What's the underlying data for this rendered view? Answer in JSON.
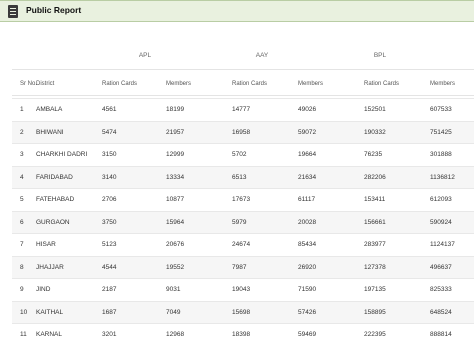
{
  "header": {
    "title": "Public Report",
    "icon": "report-icon"
  },
  "table": {
    "groups": [
      "APL",
      "AAY",
      "BPL"
    ],
    "columns": [
      "Sr No.",
      "District",
      "Ration Cards",
      "Members",
      "Ration Cards",
      "Members",
      "Ration Cards",
      "Members"
    ],
    "rows": [
      [
        "1",
        "AMBALA",
        "4561",
        "18199",
        "14777",
        "49026",
        "152501",
        "607533"
      ],
      [
        "2",
        "BHIWANI",
        "5474",
        "21957",
        "16958",
        "59072",
        "190332",
        "751425"
      ],
      [
        "3",
        "CHARKHI DADRI",
        "3150",
        "12999",
        "5702",
        "19664",
        "76235",
        "301888"
      ],
      [
        "4",
        "FARIDABAD",
        "3140",
        "13334",
        "6513",
        "21634",
        "282206",
        "1136812"
      ],
      [
        "5",
        "FATEHABAD",
        "2706",
        "10877",
        "17673",
        "61117",
        "153411",
        "612093"
      ],
      [
        "6",
        "GURGAON",
        "3750",
        "15964",
        "5979",
        "20028",
        "156661",
        "590924"
      ],
      [
        "7",
        "HISAR",
        "5123",
        "20676",
        "24674",
        "85434",
        "283977",
        "1124137"
      ],
      [
        "8",
        "JHAJJAR",
        "4544",
        "19552",
        "7987",
        "26920",
        "127378",
        "496637"
      ],
      [
        "9",
        "JIND",
        "2187",
        "9031",
        "19043",
        "71590",
        "197135",
        "825333"
      ],
      [
        "10",
        "KAITHAL",
        "1687",
        "7049",
        "15698",
        "57426",
        "158895",
        "648524"
      ],
      [
        "11",
        "KARNAL",
        "3201",
        "12968",
        "18398",
        "59469",
        "222395",
        "888814"
      ]
    ]
  }
}
